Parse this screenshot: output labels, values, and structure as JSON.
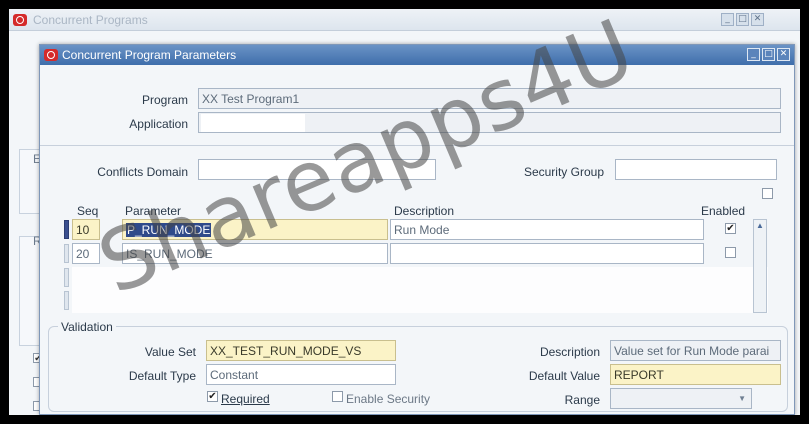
{
  "back_window": {
    "title": "Concurrent Programs",
    "side_labels": [
      "E",
      "R"
    ]
  },
  "window": {
    "title": "Concurrent Program Parameters",
    "controls": [
      "minimize-icon",
      "maximize-icon",
      "close-icon"
    ]
  },
  "header": {
    "program_label": "Program",
    "program_value": "XX Test Program1",
    "application_label": "Application",
    "application_value": "",
    "conflicts_domain_label": "Conflicts Domain",
    "conflicts_domain_value": "",
    "security_group_label": "Security Group",
    "security_group_value": ""
  },
  "table": {
    "columns": [
      "Seq",
      "Parameter",
      "Description",
      "Enabled"
    ],
    "rows": [
      {
        "seq": "10",
        "parameter": "P_RUN_MODE",
        "description": "Run Mode",
        "enabled": true
      },
      {
        "seq": "20",
        "parameter": "IS_RUN_MODE",
        "description": "",
        "enabled": false
      }
    ]
  },
  "validation": {
    "title": "Validation",
    "value_set_label": "Value Set",
    "value_set": "XX_TEST_RUN_MODE_VS",
    "description_label": "Description",
    "description": "Value set for Run Mode parai",
    "default_type_label": "Default Type",
    "default_type": "Constant",
    "default_value_label": "Default Value",
    "default_value": "REPORT",
    "required_label": "Required",
    "required": true,
    "enable_security_label": "Enable Security",
    "enable_security": false,
    "range_label": "Range",
    "range": ""
  },
  "watermark": "Shareapps4U",
  "colors": {
    "title_bar": "#3f6eab",
    "highlight": "#fbf3c7",
    "oracle_icon": "#d42a2a"
  }
}
